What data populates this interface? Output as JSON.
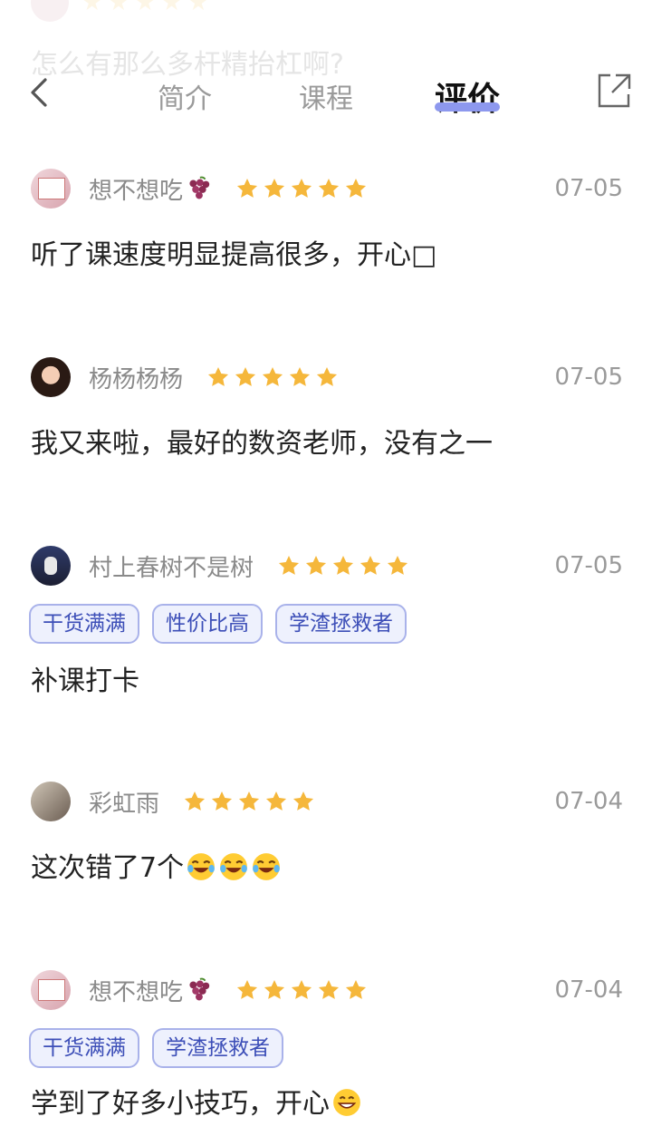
{
  "ghost": {
    "text": "怎么有那么多杆精抬杠啊?"
  },
  "header": {
    "back_icon": "chevron-left-icon",
    "share_icon": "share-icon",
    "tabs": [
      {
        "label": "简介"
      },
      {
        "label": "课程"
      },
      {
        "label": "评价"
      }
    ],
    "active_tab": "评价",
    "indicator_color": "#8d98ee"
  },
  "colors": {
    "star": "#f5b73b",
    "tag_border": "#a9b2ea",
    "tag_bg": "#eef1fd",
    "tag_text": "#3d4fb8"
  },
  "reviews": [
    {
      "name": "想不想吃",
      "name_emoji": "grape-icon",
      "rating": 5,
      "date": "07-05",
      "tags": [],
      "text": "听了课速度明显提高很多，开心",
      "text_suffix": "□"
    },
    {
      "name": "杨杨杨杨",
      "rating": 5,
      "date": "07-05",
      "tags": [],
      "text": "我又来啦，最好的数资老师，没有之一"
    },
    {
      "name": "村上春树不是树",
      "rating": 5,
      "date": "07-05",
      "tags": [
        "干货满满",
        "性价比高",
        "学渣拯救者"
      ],
      "text": "补课打卡"
    },
    {
      "name": "彩虹雨",
      "rating": 5,
      "date": "07-04",
      "tags": [],
      "text": "这次错了7个",
      "text_emojis": [
        "laugh-cry-icon",
        "laugh-cry-icon",
        "laugh-cry-icon"
      ]
    },
    {
      "name": "想不想吃",
      "name_emoji": "grape-icon",
      "rating": 5,
      "date": "07-04",
      "tags": [
        "干货满满",
        "学渣拯救者"
      ],
      "text": "学到了好多小技巧，开心",
      "text_emojis": [
        "grin-icon"
      ]
    }
  ]
}
